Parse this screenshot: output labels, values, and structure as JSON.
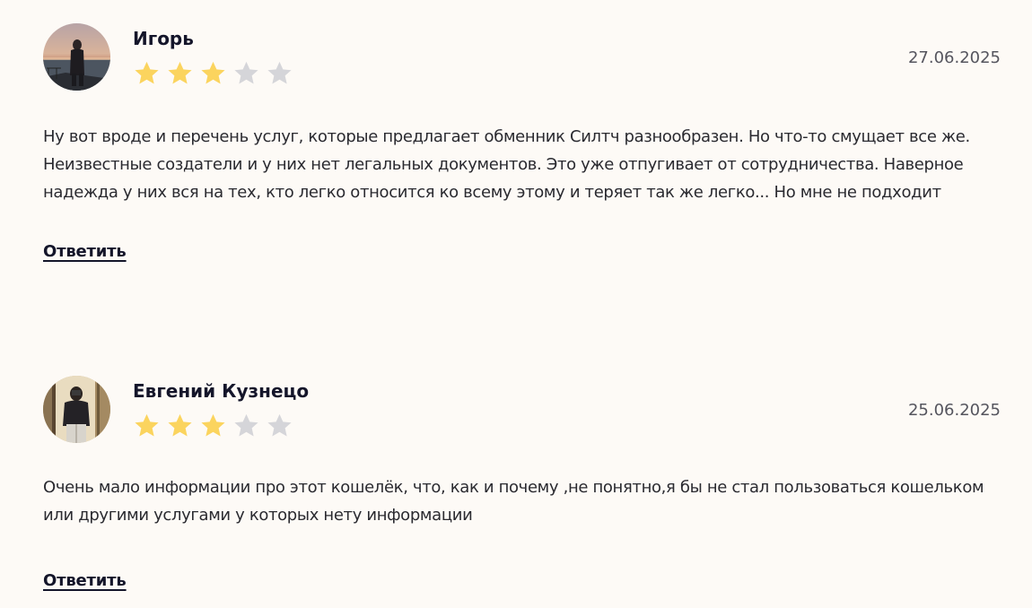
{
  "colors": {
    "background": "#fdfaf6",
    "star_filled": "#fbd45e",
    "star_empty": "#d5d5d9",
    "text": "#2a2a30",
    "heading": "#14152a",
    "date": "#55555e"
  },
  "reviews": [
    {
      "author": "Игорь",
      "date": "27.06.2025",
      "rating": 3,
      "max_rating": 5,
      "avatar_icon": "avatar-photo-sunset-sea",
      "text": "Ну вот вроде и перечень услуг, которые предлагает обменник Силтч разнообразен. Но что-то смущает все же. Неизвестные создатели и у них нет легальных документов. Это уже отпугивает от сотрудничества. Наверное надежда у них вся на тех, кто легко относится ко всему этому и теряет так же легко... Но мне не подходит",
      "reply_label": "Ответить"
    },
    {
      "author": "Евгений Кузнецо",
      "date": "25.06.2025",
      "rating": 3,
      "max_rating": 5,
      "avatar_icon": "avatar-photo-mirror-selfie",
      "text": "Очень мало информации про этот кошелёк, что, как и почему ,не понятно,я бы не стал пользоваться кошельком или другими услугами у которых нету информации",
      "reply_label": "Ответить"
    }
  ]
}
